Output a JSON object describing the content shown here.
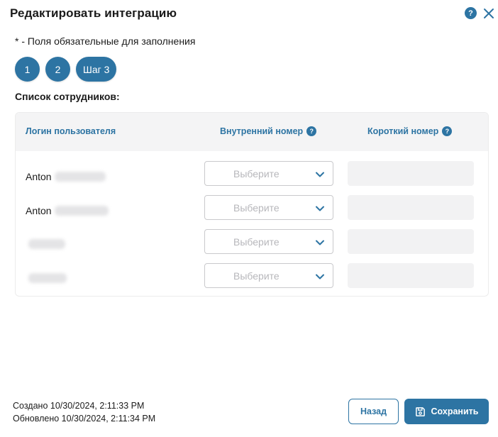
{
  "dialog": {
    "title": "Редактировать интеграцию",
    "help_icon_text": "?",
    "required_note": "* - Поля обязательные для заполнения"
  },
  "steps": [
    "1",
    "2",
    "Шаг 3"
  ],
  "employees": {
    "section_title": "Список сотрудников:",
    "columns": {
      "login": "Логин пользователя",
      "internal": "Внутренний номер",
      "short": "Короткий номер",
      "help_icon_text": "?"
    },
    "rows": [
      {
        "login": "Anton",
        "internal_placeholder": "Выберите",
        "short_value": ""
      },
      {
        "login": "Anton",
        "internal_placeholder": "Выберите",
        "short_value": ""
      },
      {
        "login": "",
        "internal_placeholder": "Выберите",
        "short_value": ""
      },
      {
        "login": "",
        "internal_placeholder": "Выберите",
        "short_value": ""
      }
    ]
  },
  "footer": {
    "created": "Создано 10/30/2024, 2:11:33 PM",
    "updated": "Обновлено 10/30/2024, 2:11:34 PM",
    "back_label": "Назад",
    "save_label": "Сохранить"
  },
  "colors": {
    "accent": "#2d74a3",
    "header_bg": "#f4f4f5",
    "field_bg": "#f2f2f3"
  },
  "icons": {
    "help": "question-circle-icon",
    "close": "close-icon",
    "dropdown": "chevron-down-icon",
    "save": "floppy-disk-icon"
  }
}
